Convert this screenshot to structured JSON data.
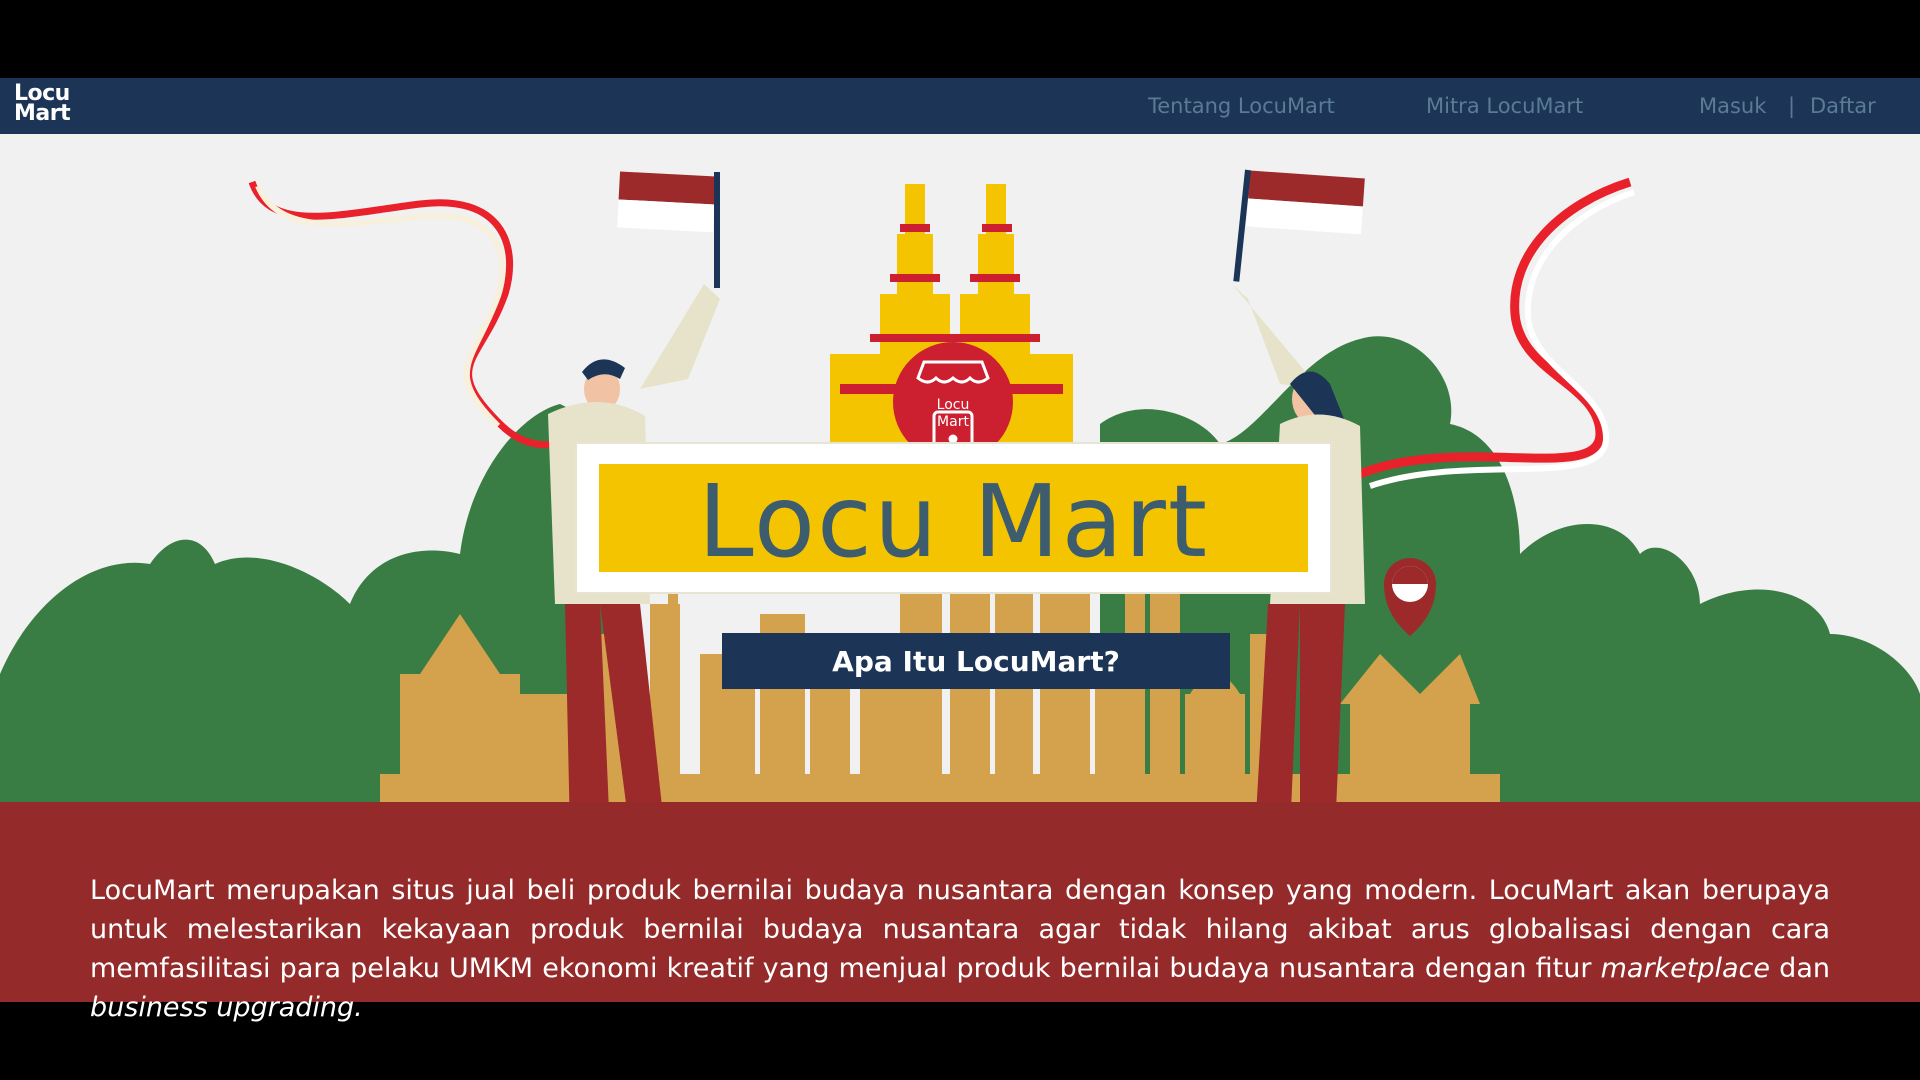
{
  "nav": {
    "logo_line1": "Locu",
    "logo_line2": "Mart",
    "about": "Tentang LocuMart",
    "partners": "Mitra LocuMart",
    "login": "Masuk",
    "separator": "|",
    "register": "Daftar"
  },
  "hero": {
    "badge_line1": "Locu",
    "badge_line2": "Mart",
    "banner_title": "Locu Mart"
  },
  "section": {
    "title": "Apa Itu LocuMart?",
    "body_part1": "LocuMart merupakan situs jual beli produk bernilai budaya nusantara dengan konsep yang modern. LocuMart akan berupaya untuk melestarikan kekayaan produk bernilai budaya nusantara agar tidak hilang akibat arus globalisasi dengan cara memfasilitasi para pelaku UMKM ekonomi kreatif yang menjual produk bernilai budaya nusantara dengan fitur ",
    "body_em1": "marketplace",
    "body_part2": " dan ",
    "body_em2": "business upgrading."
  },
  "colors": {
    "navbar": "#1c3557",
    "hero_bg": "#f1f1f1",
    "foliage": "#3a7d44",
    "skyline": "#d4a24c",
    "banner_yellow": "#f5c400",
    "title_text": "#3d5c6e",
    "description_bg": "#942a2a",
    "flag_red": "#9c2a2a",
    "badge_red": "#cc1f2f"
  },
  "icons": [
    "shop-awning-icon",
    "location-pin-icon"
  ]
}
